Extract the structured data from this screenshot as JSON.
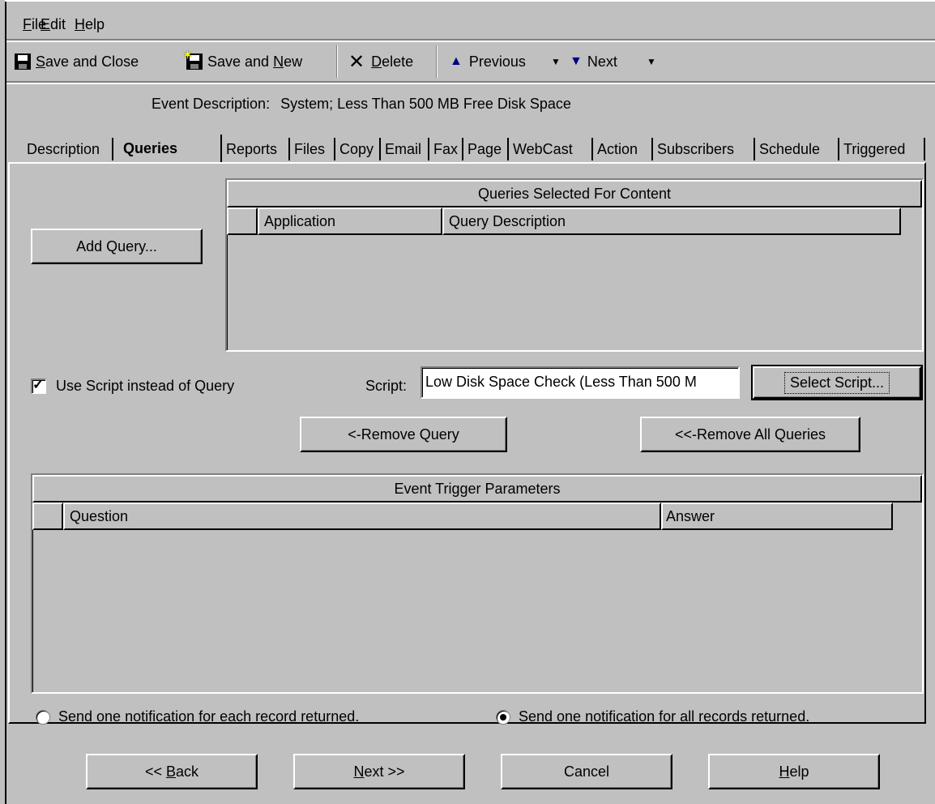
{
  "menu": {
    "file": {
      "u": "F",
      "rest": "ile"
    },
    "edit": {
      "u": "E",
      "rest": "dit"
    },
    "help": {
      "u": "H",
      "rest": "elp"
    }
  },
  "toolbar": {
    "save_close": {
      "u": "S",
      "rest": "ave and Close"
    },
    "save_new": {
      "pre": "Save and ",
      "u": "N",
      "rest": "ew"
    },
    "delete": {
      "u": "D",
      "rest": "elete"
    },
    "previous": "Previous",
    "next": "Next"
  },
  "event_description": {
    "label": "Event Description:",
    "value": "System; Less Than 500 MB Free Disk Space"
  },
  "tabs": [
    "Description",
    "Queries",
    "Reports",
    "Files",
    "Copy",
    "Email",
    "Fax",
    "Page",
    "WebCast",
    "Action",
    "Subscribers",
    "Schedule",
    "Triggered"
  ],
  "queries": {
    "add_query": "Add Query...",
    "grid_title": "Queries Selected For Content",
    "col_application": "Application",
    "col_query_description": "Query Description",
    "use_script_label": "Use Script instead of Query",
    "use_script_checked": true,
    "script_label": "Script:",
    "script_value": "Low Disk Space Check (Less Than 500 M",
    "select_script": "Select Script...",
    "remove_query": "<-Remove Query",
    "remove_all": "<<-Remove All Queries"
  },
  "trigger": {
    "grid_title": "Event Trigger Parameters",
    "col_question": "Question",
    "col_answer": "Answer"
  },
  "notify": {
    "each": "Send one notification for each record returned.",
    "all": "Send one notification for all records returned.",
    "selected": "all"
  },
  "nav": {
    "back": {
      "pre": "<< ",
      "u": "B",
      "rest": "ack"
    },
    "next": {
      "u": "N",
      "rest": "ext >>"
    },
    "cancel": "Cancel",
    "help": {
      "u": "H",
      "rest": "elp"
    }
  },
  "colors": {
    "face": "#c0c0c0",
    "shadow": "#808080",
    "highlight": "#ffffff",
    "arrow": "#000080"
  }
}
